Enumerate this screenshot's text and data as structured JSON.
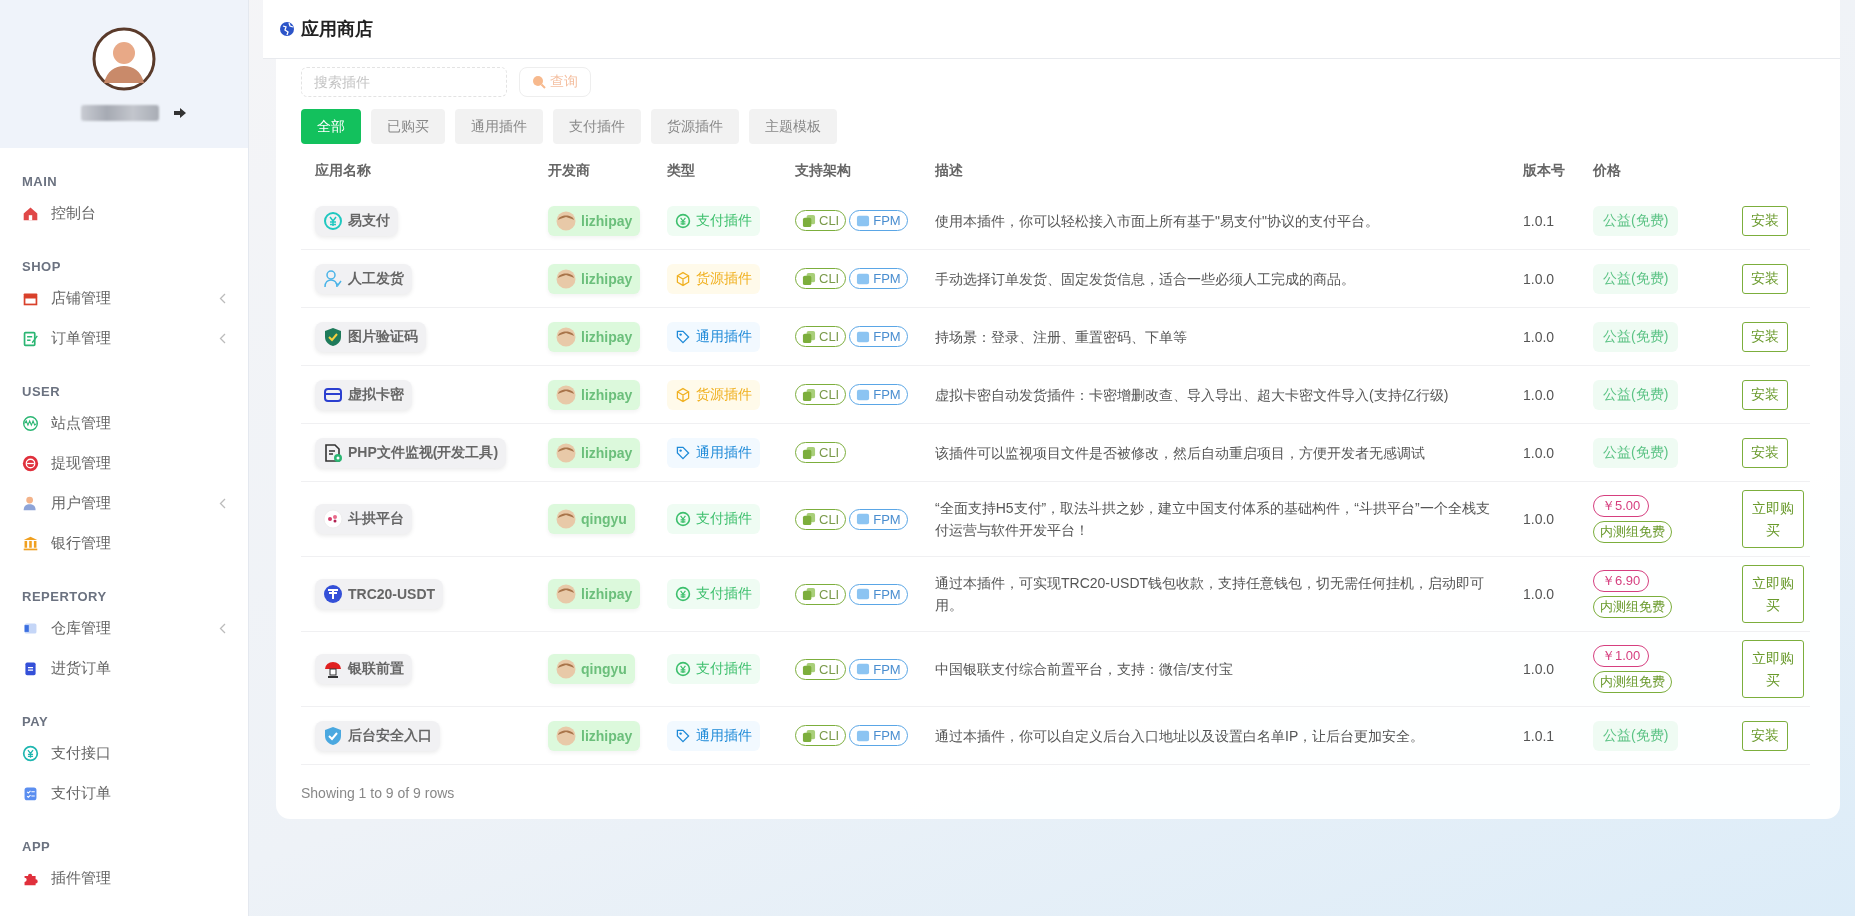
{
  "page": {
    "title": "应用商店"
  },
  "search": {
    "placeholder": "搜索插件",
    "button": "查询"
  },
  "sidebar": {
    "sections": [
      {
        "title": "MAIN",
        "items": [
          {
            "label": "控制台",
            "expandable": false
          }
        ]
      },
      {
        "title": "SHOP",
        "items": [
          {
            "label": "店铺管理",
            "expandable": true
          },
          {
            "label": "订单管理",
            "expandable": true
          }
        ]
      },
      {
        "title": "USER",
        "items": [
          {
            "label": "站点管理",
            "expandable": false
          },
          {
            "label": "提现管理",
            "expandable": false
          },
          {
            "label": "用户管理",
            "expandable": true
          },
          {
            "label": "银行管理",
            "expandable": false
          }
        ]
      },
      {
        "title": "REPERTORY",
        "items": [
          {
            "label": "仓库管理",
            "expandable": true
          },
          {
            "label": "进货订单",
            "expandable": false
          }
        ]
      },
      {
        "title": "PAY",
        "items": [
          {
            "label": "支付接口",
            "expandable": false
          },
          {
            "label": "支付订单",
            "expandable": false
          }
        ]
      },
      {
        "title": "APP",
        "items": [
          {
            "label": "插件管理",
            "expandable": false
          }
        ]
      }
    ]
  },
  "filters": [
    {
      "label": "全部",
      "selected": true
    },
    {
      "label": "已购买",
      "selected": false
    },
    {
      "label": "通用插件",
      "selected": false
    },
    {
      "label": "支付插件",
      "selected": false
    },
    {
      "label": "货源插件",
      "selected": false
    },
    {
      "label": "主题模板",
      "selected": false
    }
  ],
  "table": {
    "columns": [
      "应用名称",
      "开发商",
      "类型",
      "支持架构",
      "描述",
      "版本号",
      "价格"
    ],
    "rows": [
      {
        "name": "易支付",
        "developer": "lizhipay",
        "type": {
          "kind": "pay",
          "label": "支付插件"
        },
        "arch": [
          "CLI",
          "FPM"
        ],
        "description": "使用本插件，你可以轻松接入市面上所有基于\"易支付\"协议的支付平台。",
        "version": "1.0.1",
        "price": {
          "kind": "free",
          "label": "公益(免费)"
        },
        "action": "安装"
      },
      {
        "name": "人工发货",
        "developer": "lizhipay",
        "type": {
          "kind": "goods",
          "label": "货源插件"
        },
        "arch": [
          "CLI",
          "FPM"
        ],
        "description": "手动选择订单发货、固定发货信息，适合一些必须人工完成的商品。",
        "version": "1.0.0",
        "price": {
          "kind": "free",
          "label": "公益(免费)"
        },
        "action": "安装"
      },
      {
        "name": "图片验证码",
        "developer": "lizhipay",
        "type": {
          "kind": "general",
          "label": "通用插件"
        },
        "arch": [
          "CLI",
          "FPM"
        ],
        "description": "持场景：登录、注册、重置密码、下单等",
        "version": "1.0.0",
        "price": {
          "kind": "free",
          "label": "公益(免费)"
        },
        "action": "安装"
      },
      {
        "name": "虚拟卡密",
        "developer": "lizhipay",
        "type": {
          "kind": "goods",
          "label": "货源插件"
        },
        "arch": [
          "CLI",
          "FPM"
        ],
        "description": "虚拟卡密自动发货插件：卡密增删改查、导入导出、超大卡密文件导入(支持亿行级)",
        "version": "1.0.0",
        "price": {
          "kind": "free",
          "label": "公益(免费)"
        },
        "action": "安装"
      },
      {
        "name": "PHP文件监视(开发工具)",
        "developer": "lizhipay",
        "type": {
          "kind": "general",
          "label": "通用插件"
        },
        "arch": [
          "CLI"
        ],
        "description": "该插件可以监视项目文件是否被修改，然后自动重启项目，方便开发者无感调试",
        "version": "1.0.0",
        "price": {
          "kind": "free",
          "label": "公益(免费)"
        },
        "action": "安装"
      },
      {
        "name": "斗拱平台",
        "developer": "qingyu",
        "type": {
          "kind": "pay",
          "label": "支付插件"
        },
        "arch": [
          "CLI",
          "FPM"
        ],
        "description": "“全面支持H5支付”，取法斗拱之妙，建立中国支付体系的基础构件，“斗拱平台”一个全栈支付运营与软件开发平台！",
        "version": "1.0.0",
        "price": {
          "kind": "paid",
          "amount": "￥5.00",
          "note": "内测组免费"
        },
        "action": "立即购买"
      },
      {
        "name": "TRC20-USDT",
        "developer": "lizhipay",
        "type": {
          "kind": "pay",
          "label": "支付插件"
        },
        "arch": [
          "CLI",
          "FPM"
        ],
        "description": "通过本插件，可实现TRC20-USDT钱包收款，支持任意钱包，切无需任何挂机，启动即可用。",
        "version": "1.0.0",
        "price": {
          "kind": "paid",
          "amount": "￥6.90",
          "note": "内测组免费"
        },
        "action": "立即购买"
      },
      {
        "name": "银联前置",
        "developer": "qingyu",
        "type": {
          "kind": "pay",
          "label": "支付插件"
        },
        "arch": [
          "CLI",
          "FPM"
        ],
        "description": "中国银联支付综合前置平台，支持：微信/支付宝",
        "version": "1.0.0",
        "price": {
          "kind": "paid",
          "amount": "￥1.00",
          "note": "内测组免费"
        },
        "action": "立即购买"
      },
      {
        "name": "后台安全入口",
        "developer": "lizhipay",
        "type": {
          "kind": "general",
          "label": "通用插件"
        },
        "arch": [
          "CLI",
          "FPM"
        ],
        "description": "通过本插件，你可以自定义后台入口地址以及设置白名单IP，让后台更加安全。",
        "version": "1.0.1",
        "price": {
          "kind": "free",
          "label": "公益(免费)"
        },
        "action": "安装"
      }
    ],
    "footer": "Showing 1 to 9 of 9 rows"
  }
}
